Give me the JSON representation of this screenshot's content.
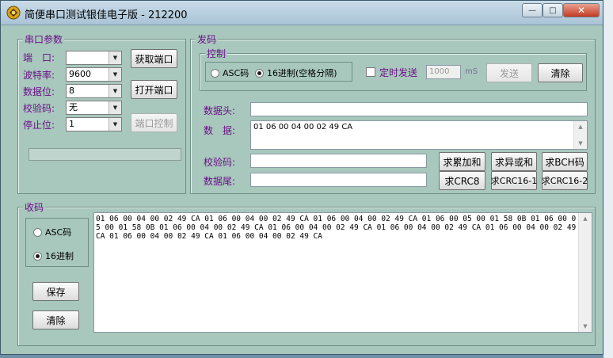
{
  "window": {
    "title": "简便串口测试银佳电子版 - 212200",
    "minimize_symbol": "—",
    "maximize_symbol": "□",
    "close_symbol": "✕"
  },
  "serial_group": {
    "title": "串口参数",
    "port_label": "端　口:",
    "port_value": "",
    "baud_label": "波特率:",
    "baud_value": "9600",
    "databits_label": "数据位:",
    "databits_value": "8",
    "parity_label": "校验码:",
    "parity_value": "无",
    "stopbits_label": "停止位:",
    "stopbits_value": "1",
    "get_port_button": "获取端口",
    "open_port_button": "打开端口",
    "port_control_button": "端口控制"
  },
  "send_group": {
    "title": "发码",
    "control_title": "控制",
    "mode_ascii": "ASC码",
    "mode_hex": "16进制(空格分隔)",
    "timed_send_label": "定时发送",
    "interval_value": "1000",
    "interval_unit": "mS",
    "send_button": "发送",
    "clear_button": "清除",
    "header_label": "数据头:",
    "header_value": "",
    "data_label": "数　据:",
    "data_value": "01 06 00 04 00 02 49 CA",
    "checksum_label": "校验码:",
    "checksum_value": "",
    "tail_label": "数据尾:",
    "tail_value": "",
    "sum_button": "求累加和",
    "xor_button": "求异或和",
    "bch_button": "求BCH码",
    "crc8_button": "求CRC8",
    "crc16_1_button": "求CRC16-1",
    "crc16_2_button": "求CRC16-2"
  },
  "recv_group": {
    "title": "收码",
    "mode_ascii": "ASC码",
    "mode_hex": "16进制",
    "save_button": "保存",
    "clear_button": "清除",
    "received_text": "01 06 00 04 00 02 49 CA 01 06 00 04 00 02 49 CA 01 06 00 04 00 02 49 CA 01 06 00 05 00 01 58 0B 01 06 00 05 00 01 58 0B 01 06 00 04 00 02 49 CA 01 06 00 04 00 02 49 CA 01 06 00 04 00 02 49 CA 01 06 00 04 00 02 49 CA 01 06 00 04 00 02 49 CA 01 06 00 04 00 02 49 CA"
  },
  "state": {
    "send_mode": "hex",
    "recv_mode": "hex",
    "timed_send_checked": false
  }
}
